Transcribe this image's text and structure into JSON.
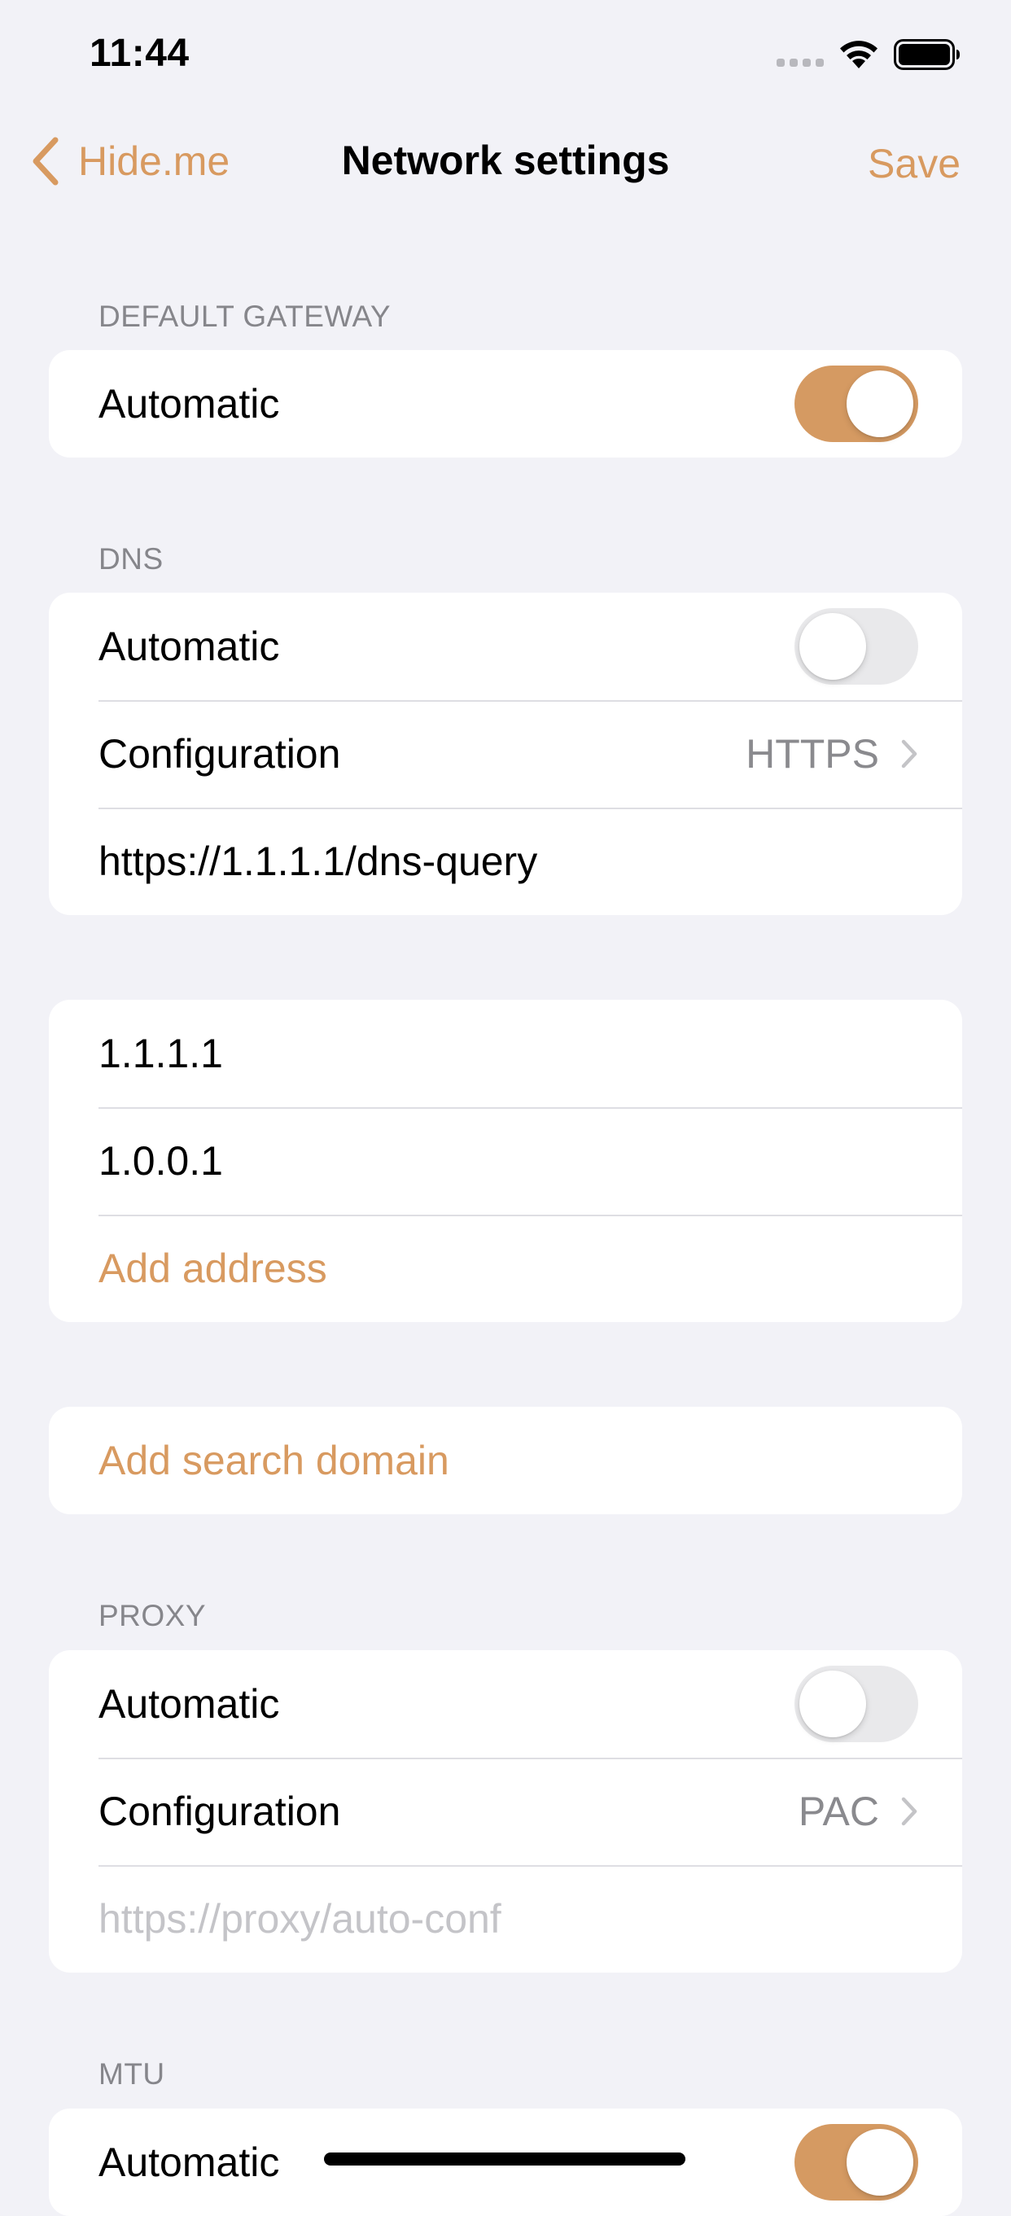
{
  "status_bar": {
    "time": "11:44"
  },
  "nav": {
    "back_label": "Hide.me",
    "title": "Network settings",
    "save_label": "Save"
  },
  "colors": {
    "accent": "#d89a60",
    "toggle_on": "#d59a62",
    "background": "#f2f2f7"
  },
  "default_gateway": {
    "header": "DEFAULT GATEWAY",
    "automatic_label": "Automatic",
    "automatic_on": true
  },
  "dns": {
    "header": "DNS",
    "automatic_label": "Automatic",
    "automatic_on": false,
    "configuration_label": "Configuration",
    "configuration_value": "HTTPS",
    "url": "https://1.1.1.1/dns-query",
    "addresses": [
      "1.1.1.1",
      "1.0.0.1"
    ],
    "add_address_label": "Add address",
    "add_search_domain_label": "Add search domain"
  },
  "proxy": {
    "header": "PROXY",
    "automatic_label": "Automatic",
    "automatic_on": false,
    "configuration_label": "Configuration",
    "configuration_value": "PAC",
    "url_placeholder": "https://proxy/auto-conf"
  },
  "mtu": {
    "header": "MTU",
    "automatic_label": "Automatic",
    "automatic_on": true
  },
  "icons": {
    "back": "chevron-left-icon",
    "disclosure": "chevron-right-icon",
    "wifi": "wifi-icon",
    "battery": "battery-icon"
  }
}
